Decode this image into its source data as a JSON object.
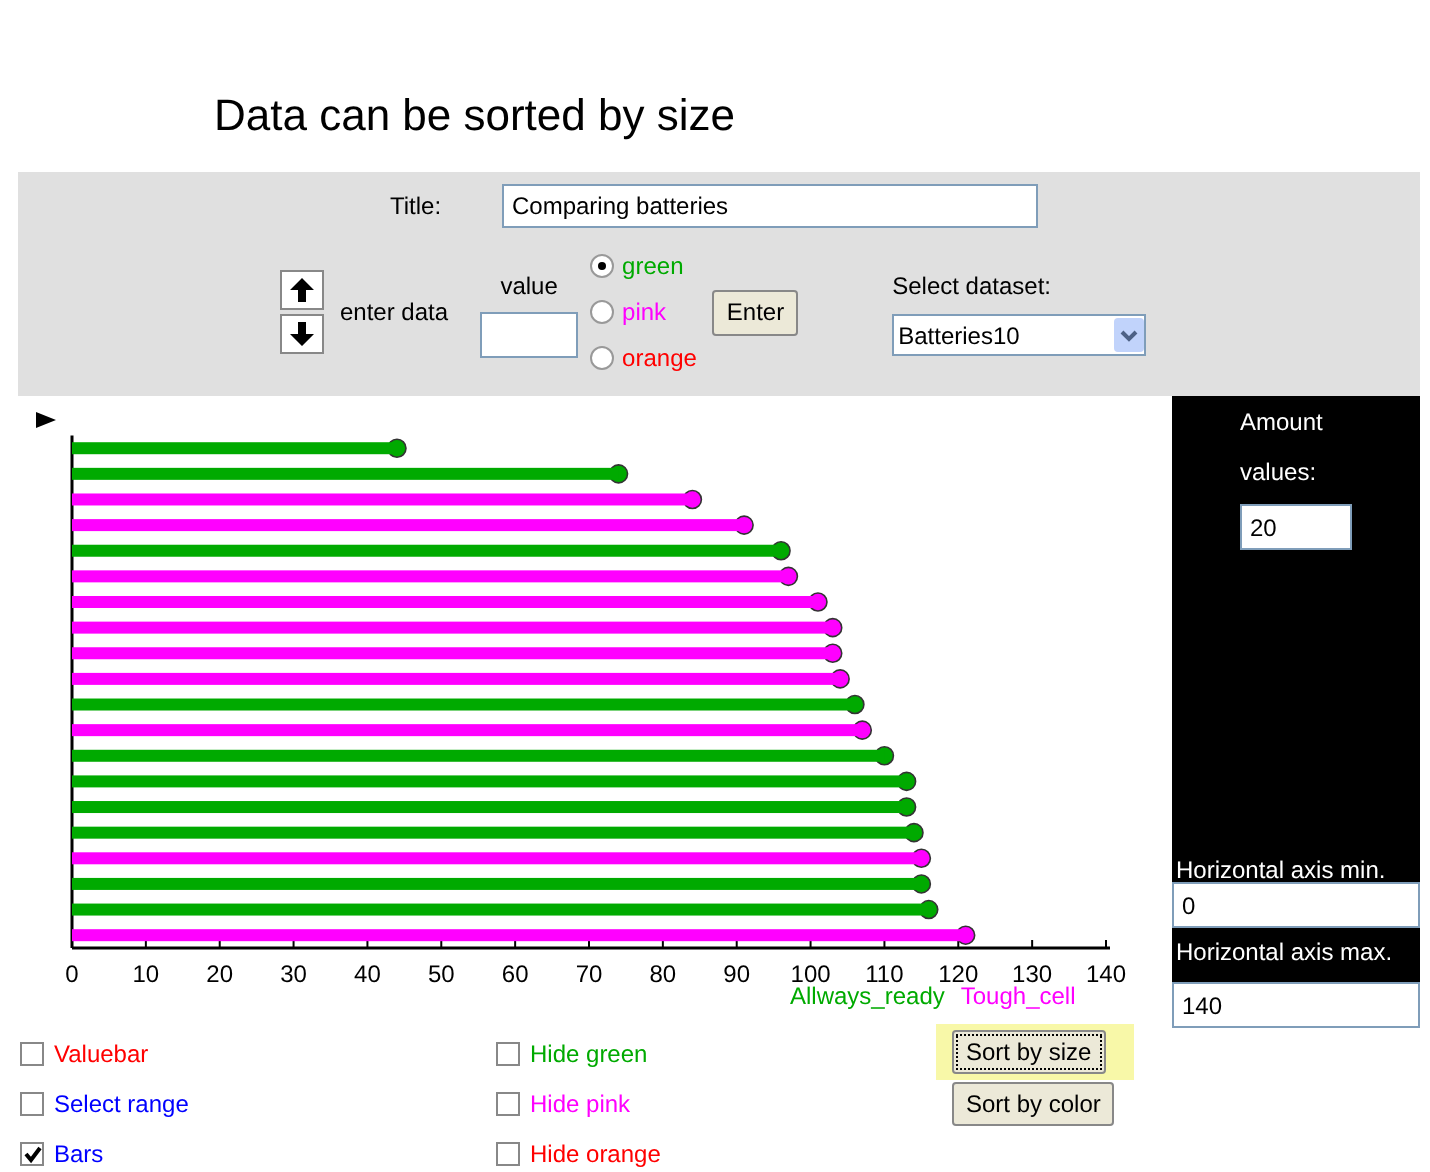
{
  "heading": "Data can be sorted by size",
  "controls": {
    "title_label": "Title:",
    "title_value": "Comparing batteries",
    "enter_data_label": "enter data",
    "value_label": "value",
    "colors": [
      {
        "label": "green",
        "color": "#00aa00",
        "selected": true
      },
      {
        "label": "pink",
        "color": "#ff00ff",
        "selected": false
      },
      {
        "label": "orange",
        "color": "#ff0000",
        "selected": false
      }
    ],
    "enter_button": "Enter",
    "dataset_label": "Select dataset:",
    "dataset_value": "Batteries10"
  },
  "chart": {
    "chart_data": {
      "type": "bar",
      "orientation": "horizontal",
      "xlim": [
        0,
        140
      ],
      "xticks": [
        0,
        10,
        20,
        30,
        40,
        50,
        60,
        70,
        80,
        90,
        100,
        110,
        120,
        130,
        140
      ],
      "series": [
        {
          "name": "Allways_ready",
          "color": "#00aa00",
          "values": [
            44,
            74,
            null,
            null,
            96,
            null,
            null,
            null,
            null,
            null,
            106,
            null,
            110,
            113,
            113,
            114,
            null,
            115,
            116,
            null
          ]
        },
        {
          "name": "Tough_cell",
          "color": "#ff00ff",
          "values": [
            null,
            null,
            84,
            91,
            null,
            97,
            101,
            103,
            103,
            104,
            null,
            107,
            null,
            null,
            null,
            null,
            115,
            null,
            null,
            121
          ]
        }
      ]
    }
  },
  "side_panel": {
    "amount_label_1": "Amount",
    "amount_label_2": "values:",
    "amount_value": "20",
    "min_label": "Horizontal axis min.",
    "min_value": "0",
    "max_label": "Horizontal axis max.",
    "max_value": "140"
  },
  "checkboxes": [
    {
      "label": "Valuebar",
      "color": "#ff0000",
      "checked": false
    },
    {
      "label": "Hide green",
      "color": "#00aa00",
      "checked": false
    },
    {
      "label": "Select range",
      "color": "#0000ff",
      "checked": false
    },
    {
      "label": "Hide pink",
      "color": "#ff00ff",
      "checked": false
    },
    {
      "label": "Bars",
      "color": "#0000ff",
      "checked": true
    },
    {
      "label": "Hide orange",
      "color": "#ff0000",
      "checked": false
    }
  ],
  "buttons": [
    {
      "label": "Sort by size",
      "highlighted": true
    },
    {
      "label": "Sort by color",
      "highlighted": false
    }
  ]
}
